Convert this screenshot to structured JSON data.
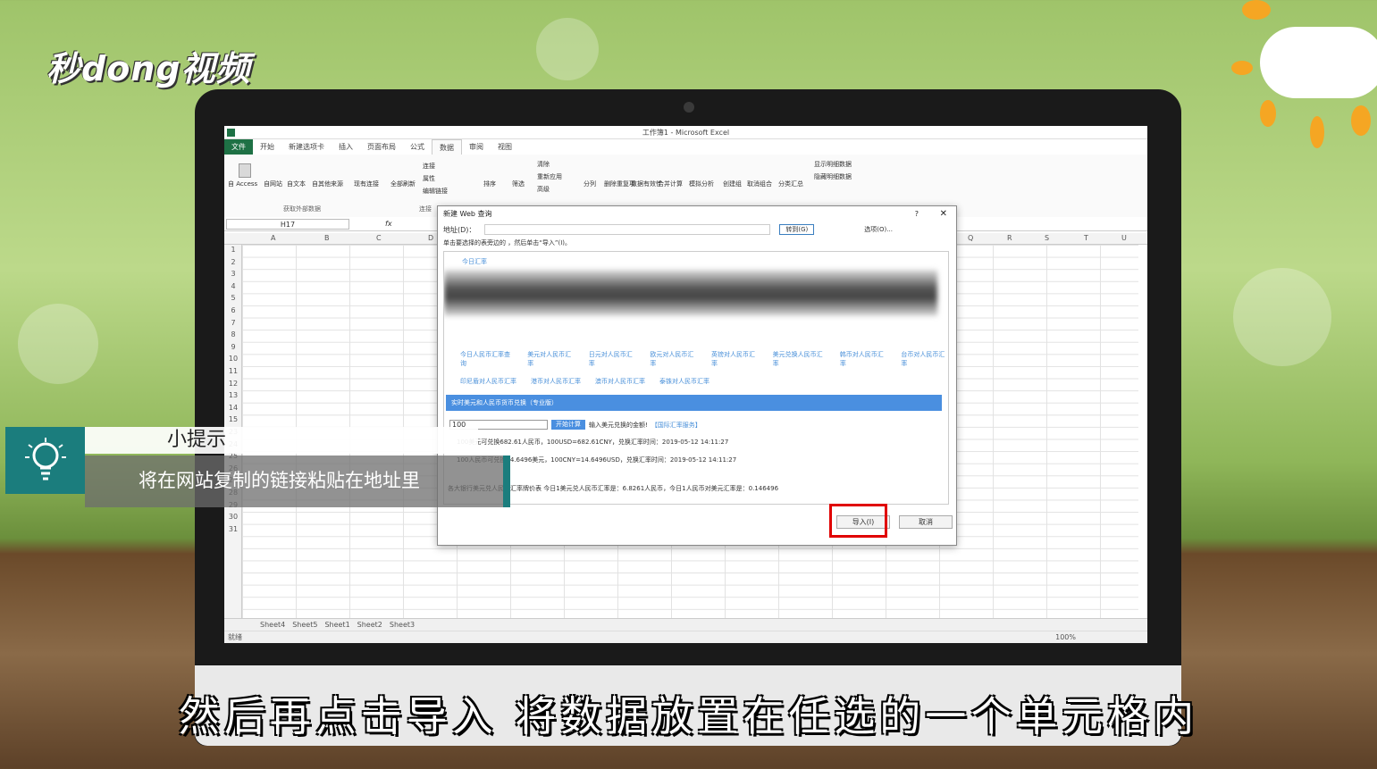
{
  "watermark": {
    "logo_text": "秒dong视频"
  },
  "excel": {
    "window_title": "工作簿1 - Microsoft Excel",
    "tabs": [
      "文件",
      "开始",
      "新建选项卡",
      "插入",
      "页面布局",
      "公式",
      "数据",
      "审阅",
      "视图"
    ],
    "active_tab": "数据",
    "ribbon_buttons": [
      "自 Access",
      "自网站",
      "自文本",
      "自其他来源",
      "现有连接",
      "全部刷新",
      "排序",
      "筛选",
      "分列",
      "删除重复项",
      "数据有效性",
      "合并计算",
      "模拟分析",
      "创建组",
      "取消组合",
      "分类汇总"
    ],
    "ribbon_small": [
      "连接",
      "属性",
      "编辑链接",
      "清除",
      "重新应用",
      "高级",
      "显示明细数据",
      "隐藏明细数据"
    ],
    "group_labels": [
      "获取外部数据",
      "连接"
    ],
    "name_box": "H17",
    "fx": "fx",
    "columns": [
      "A",
      "B",
      "C",
      "D",
      "Q",
      "R",
      "S",
      "T",
      "U"
    ],
    "rows": [
      "1",
      "2",
      "3",
      "4",
      "5",
      "6",
      "7",
      "8",
      "9",
      "10",
      "11",
      "12",
      "13",
      "14",
      "15",
      "23",
      "24",
      "25",
      "26",
      "27",
      "28",
      "29",
      "30",
      "31"
    ],
    "sheets": [
      "Sheet4",
      "Sheet5",
      "Sheet1",
      "Sheet2",
      "Sheet3"
    ],
    "status": "就绪",
    "zoom": "100%"
  },
  "dialog": {
    "title": "新建 Web 查询",
    "help": "?",
    "address_label": "地址(D)：",
    "go_button": "转到(G)",
    "options": "选项(O)...",
    "hint": "单击要选择的表旁边的 ，然后单击“导入”(I)。",
    "page_link": "今日汇率",
    "links_row1": [
      "今日人民币汇率查询",
      "美元对人民币汇率",
      "日元对人民币汇率",
      "欧元对人民币汇率",
      "英镑对人民币汇率",
      "美元兑换人民币汇率",
      "韩币对人民币汇率",
      "台币对人民币汇率"
    ],
    "links_row2": [
      "印尼盾对人民币汇率",
      "港币对人民币汇率",
      "澳币对人民币汇率",
      "泰铢对人民币汇率"
    ],
    "blue_bar": "实时美元和人民币货币兑换（专业版）",
    "amount_value": "100",
    "calc_button": "开始计算",
    "calc_hint": "输入美元兑换的金额!",
    "calc_link": "【国际汇率服务】",
    "result1": "100美元可兑换682.61人民币，100USD=682.61CNY，兑换汇率时间：2019-05-12 14:11:27",
    "result2": "100人民币可兑换14.6496美元，100CNY=14.6496USD，兑换汇率时间：2019-05-12 14:11:27",
    "result3": "各大银行美元兑人民币汇率牌价表 今日1美元兑人民币汇率是：6.8261人民币，今日1人民币对美元汇率是：0.146496",
    "import_button": "导入(I)",
    "cancel_button": "取消"
  },
  "tip": {
    "title": "小提示",
    "body": "将在网站复制的链接粘贴在地址里"
  },
  "subtitle": "然后再点击导入  将数据放置在任选的一个单元格内"
}
